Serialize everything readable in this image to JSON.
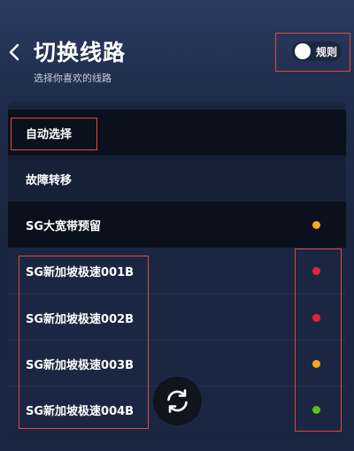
{
  "header": {
    "title": "切换线路",
    "subtitle": "选择你喜欢的线路",
    "back_icon": "chevron-left-icon",
    "rules_toggle": {
      "label": "规则",
      "on": false
    }
  },
  "lines": [
    {
      "name": "自动选择",
      "status": null
    },
    {
      "name": "故障转移",
      "status": null
    },
    {
      "name": "SG大宽带预留",
      "status": "#f5a623"
    },
    {
      "name": "SG新加坡极速001B",
      "status": "#e8213a"
    },
    {
      "name": "SG新加坡极速002B",
      "status": "#e8213a"
    },
    {
      "name": "SG新加坡极速003B",
      "status": "#f5a623"
    },
    {
      "name": "SG新加坡极速004B",
      "status": "#5cc21c"
    }
  ],
  "refresh_icon": "refresh-icon",
  "colors": {
    "annotation": "#e0483f",
    "selected_row": "#0b111c"
  }
}
